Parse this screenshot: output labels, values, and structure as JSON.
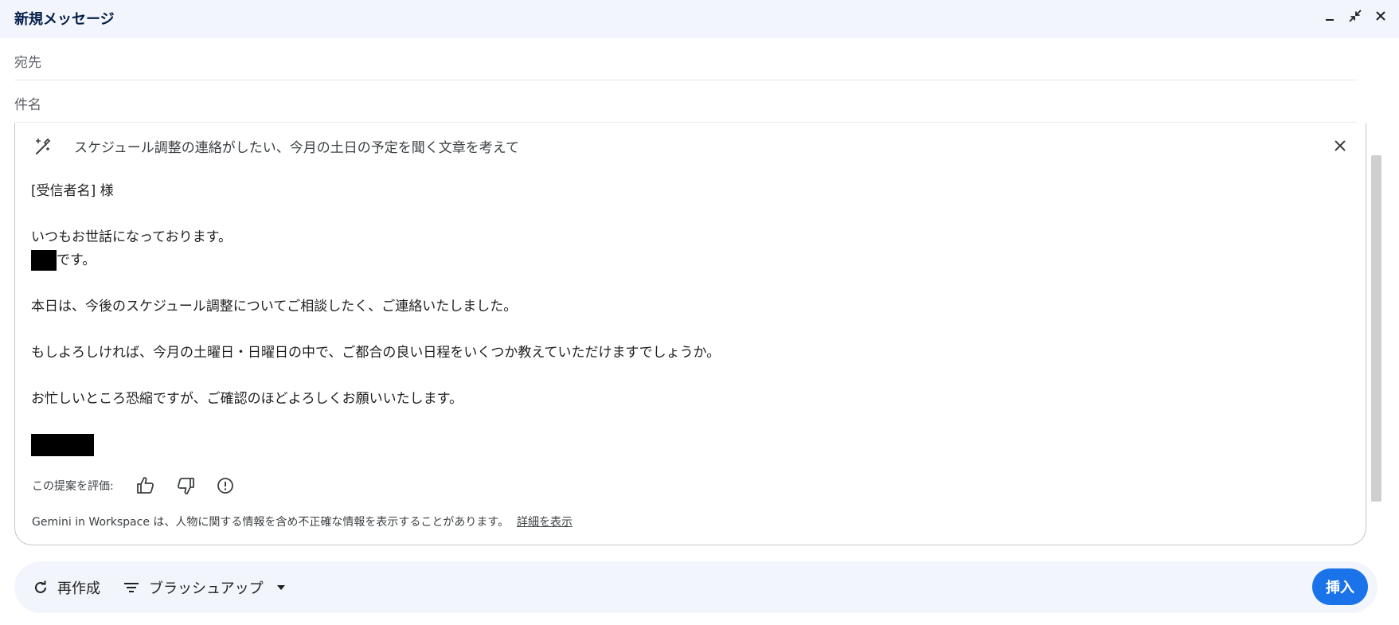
{
  "window": {
    "title": "新規メッセージ",
    "minimize_icon": "minimize-icon",
    "exit_fullscreen_icon": "exit-fullscreen-icon",
    "close_icon": "close-icon"
  },
  "fields": {
    "to_label": "宛先",
    "to_value": "",
    "subject_label": "件名",
    "subject_value": ""
  },
  "ai_panel": {
    "prompt_icon": "magic-wand-icon",
    "prompt": "スケジュール調整の連絡がしたい、今月の土日の予定を聞く文章を考えて",
    "close_icon": "close-icon",
    "draft": {
      "salutation": "[受信者名] 様",
      "greeting": "いつもお世話になっております。",
      "self_intro_suffix": "です。",
      "para1": "本日は、今後のスケジュール調整についてご相談したく、ご連絡いたしました。",
      "para2": "もしよろしければ、今月の土曜日・日曜日の中で、ご都合の良い日程をいくつか教えていただけますでしょうか。",
      "para3": "お忙しいところ恐縮ですが、ご確認のほどよろしくお願いいたします。"
    },
    "rating_label": "この提案を評価:",
    "disclaimer": "Gemini in Workspace は、人物に関する情報を含め不正確な情報を表示することがあります。",
    "details_link": "詳細を表示"
  },
  "toolbar": {
    "recreate_label": "再作成",
    "refine_label": "ブラッシュアップ",
    "insert_label": "挿入"
  },
  "colors": {
    "accent": "#1a73e8",
    "header_bg": "#f2f6fc",
    "title_text": "#041e49"
  }
}
